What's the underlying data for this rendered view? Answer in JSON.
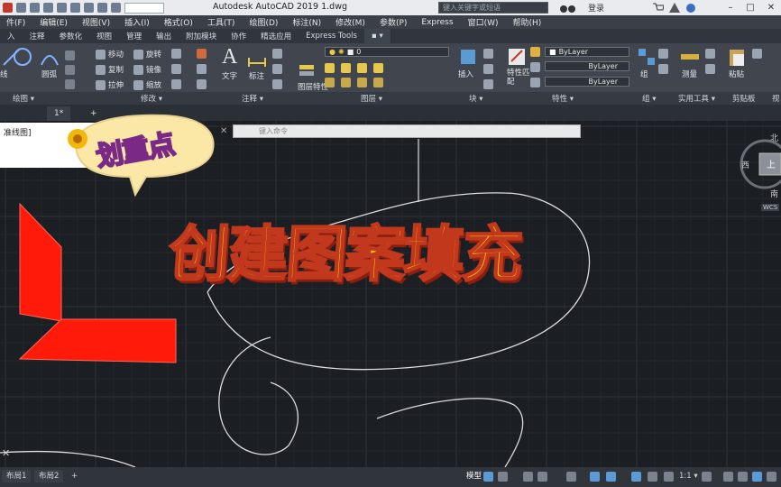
{
  "window": {
    "title": "Autodesk AutoCAD 2019    1.dwg",
    "search_placeholder": "键入关键字或短语",
    "login": "登录",
    "min": "–",
    "max": "□",
    "close": "✕"
  },
  "menubar": {
    "items": [
      "件(F)",
      "编辑(E)",
      "视图(V)",
      "插入(I)",
      "格式(O)",
      "工具(T)",
      "绘图(D)",
      "标注(N)",
      "修改(M)",
      "参数(P)",
      "Express",
      "窗口(W)",
      "帮助(H)"
    ]
  },
  "ribbon_tabs": {
    "items": [
      "入",
      "注释",
      "参数化",
      "视图",
      "管理",
      "输出",
      "附加模块",
      "协作",
      "精选应用",
      "Express Tools"
    ]
  },
  "ribbon": {
    "draw": {
      "line": "线",
      "circle": "圆弧"
    },
    "modify": {
      "move": "移动",
      "rotate": "旋转",
      "copy": "复制",
      "mirror": "镜像",
      "stretch": "拉伸",
      "scale": "缩放"
    },
    "annotation": {
      "text": "文字",
      "dim": "标注"
    },
    "layers": {
      "current_layer": "0",
      "properties": "图层特性"
    },
    "block": {
      "insert": "插入"
    },
    "properties": {
      "match": "特性匹配",
      "color": "ByLayer",
      "linetype": "ByLayer",
      "lineweight": "ByLayer"
    },
    "group": {
      "label": "组"
    },
    "utilities": {
      "measure": "测量"
    },
    "clipboard": {
      "paste": "粘贴"
    }
  },
  "panel_labels": {
    "draw": "绘图 ▾",
    "modify": "修改 ▾",
    "annotation": "注释 ▾",
    "layers": "图层 ▾",
    "block": "块 ▾",
    "properties": "特性 ▾",
    "group": "组 ▾",
    "utilities": "实用工具 ▾",
    "clipboard": "剪贴板",
    "more": "视"
  },
  "doc_tabs": {
    "tab1": "1*",
    "add": "+"
  },
  "command_line": {
    "placeholder": "键入命令",
    "close": "✕"
  },
  "layer_panel": {
    "text": "准线图]"
  },
  "viewcube": {
    "north": "北",
    "west": "西",
    "top": "上",
    "south": "南",
    "wcs": "WCS"
  },
  "sticker": {
    "text": "划重点"
  },
  "headline": {
    "text": "创建图案填充"
  },
  "status": {
    "layout1": "布局1",
    "layout2": "布局2",
    "add": "+",
    "model": "模型",
    "scale": "1:1 ▾"
  },
  "colors": {
    "accent_red": "#ff1a0a",
    "headline_yellow": "#ffd400",
    "headline_stroke": "#c1381d",
    "canvas": "#1b1e22"
  }
}
